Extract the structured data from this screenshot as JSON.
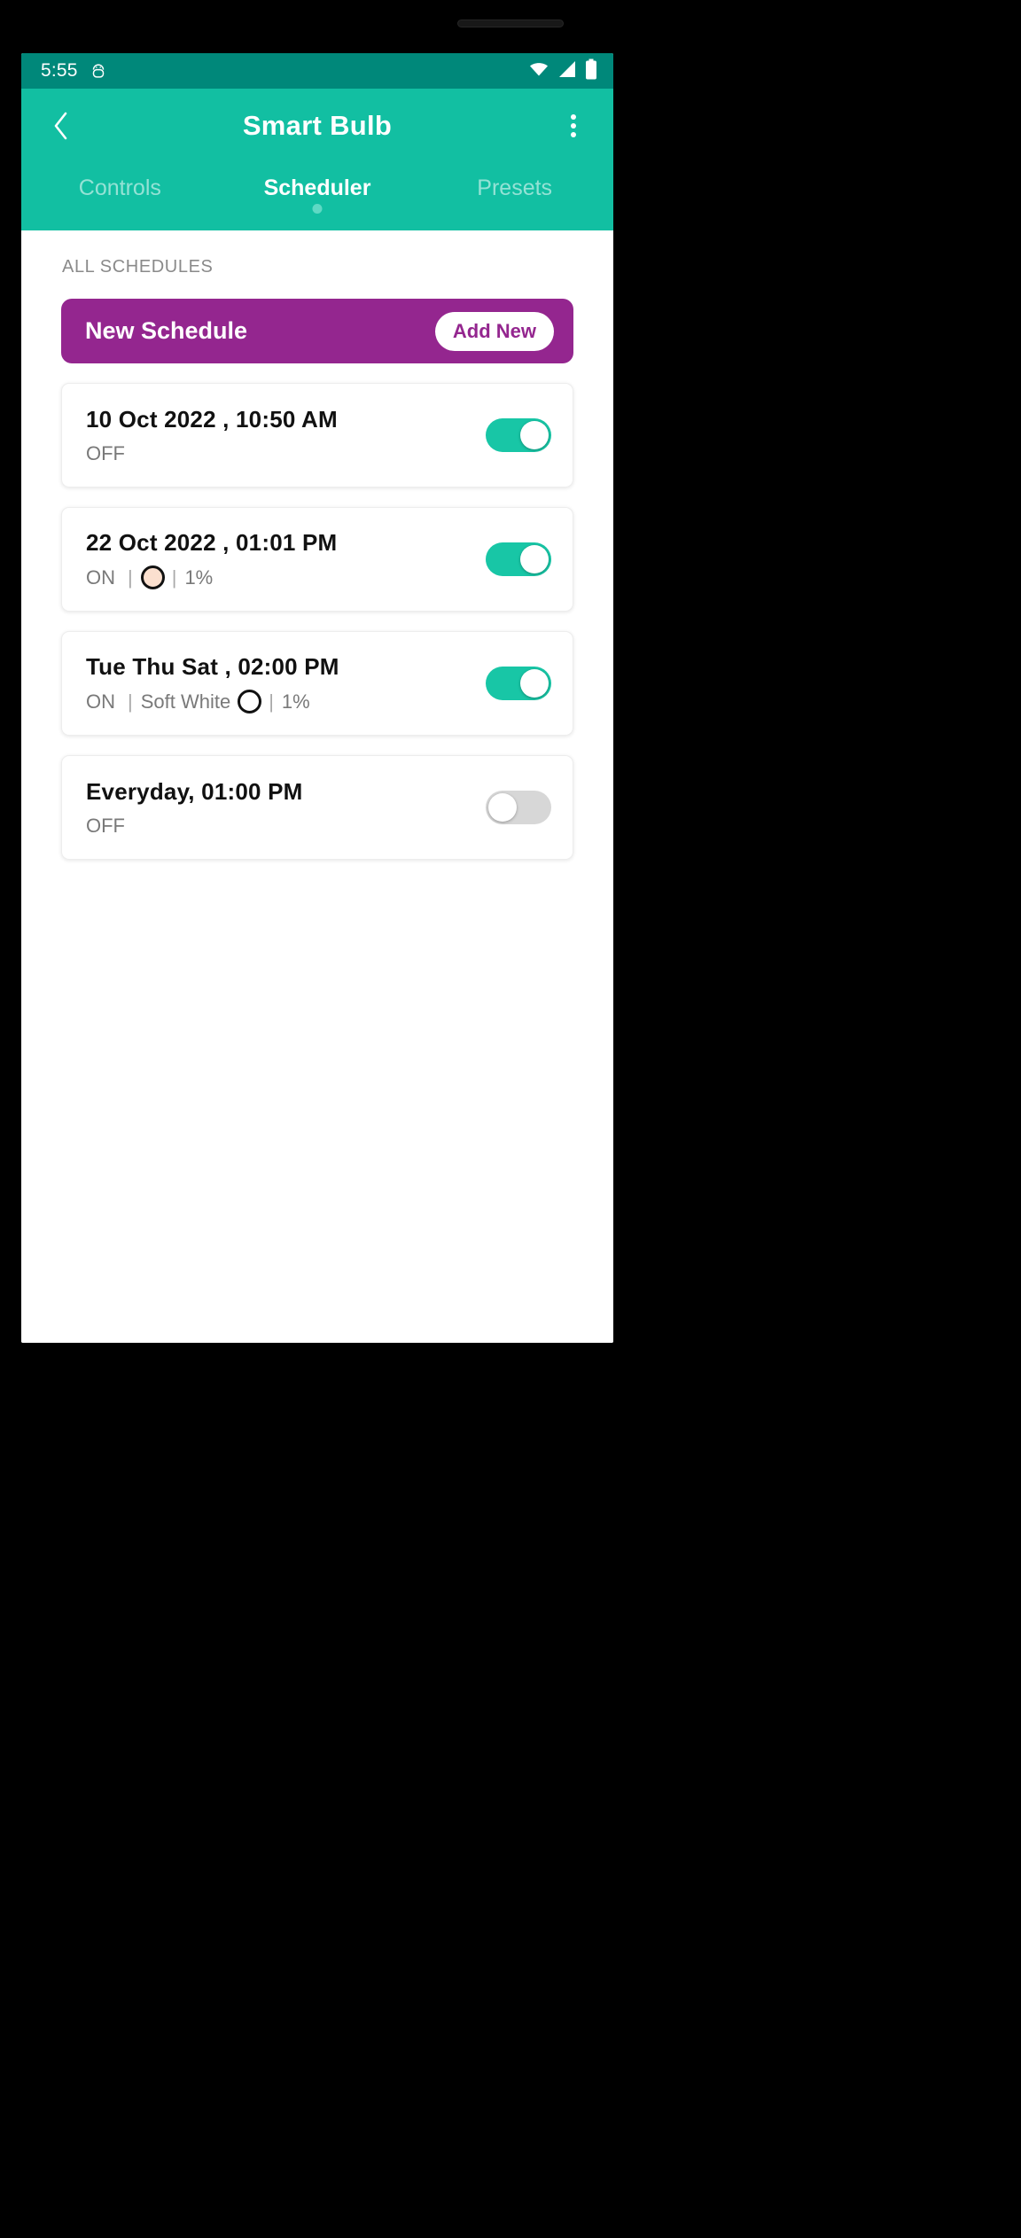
{
  "statusbar": {
    "time": "5:55",
    "icons": [
      "android-icon",
      "wifi-icon",
      "cellular-signal-icon",
      "battery-icon"
    ]
  },
  "appbar": {
    "title": "Smart Bulb",
    "back_icon": "back-chevron-icon",
    "overflow_icon": "overflow-menu-icon"
  },
  "tabs": [
    {
      "label": "Controls",
      "active": false
    },
    {
      "label": "Scheduler",
      "active": true
    },
    {
      "label": "Presets",
      "active": false
    }
  ],
  "content": {
    "section_label": "ALL SCHEDULES",
    "banner": {
      "title": "New Schedule",
      "button_label": "Add New",
      "bg_color": "#94268F",
      "button_text_color": "#94268F"
    },
    "schedules": [
      {
        "title": "10 Oct 2022 , 10:50 AM",
        "state": "OFF",
        "color_name": "",
        "color_hex": "",
        "brightness": "",
        "enabled": true
      },
      {
        "title": "22 Oct 2022 , 01:01 PM",
        "state": "ON",
        "color_name": "",
        "color_hex": "#FBE0CF",
        "brightness": "1%",
        "enabled": true
      },
      {
        "title": "Tue Thu Sat , 02:00 PM",
        "state": "ON",
        "color_name": "Soft White",
        "color_hex": "#FFFFFF",
        "brightness": "1%",
        "enabled": true
      },
      {
        "title": "Everyday, 01:00 PM",
        "state": "OFF",
        "color_name": "",
        "color_hex": "",
        "brightness": "",
        "enabled": false
      }
    ],
    "separator": "|"
  },
  "theme": {
    "status_bar_color": "#00887A",
    "app_bar_color": "#12BFA2",
    "accent_color": "#18C6A6",
    "switch_off_color": "#D7D7D7"
  }
}
